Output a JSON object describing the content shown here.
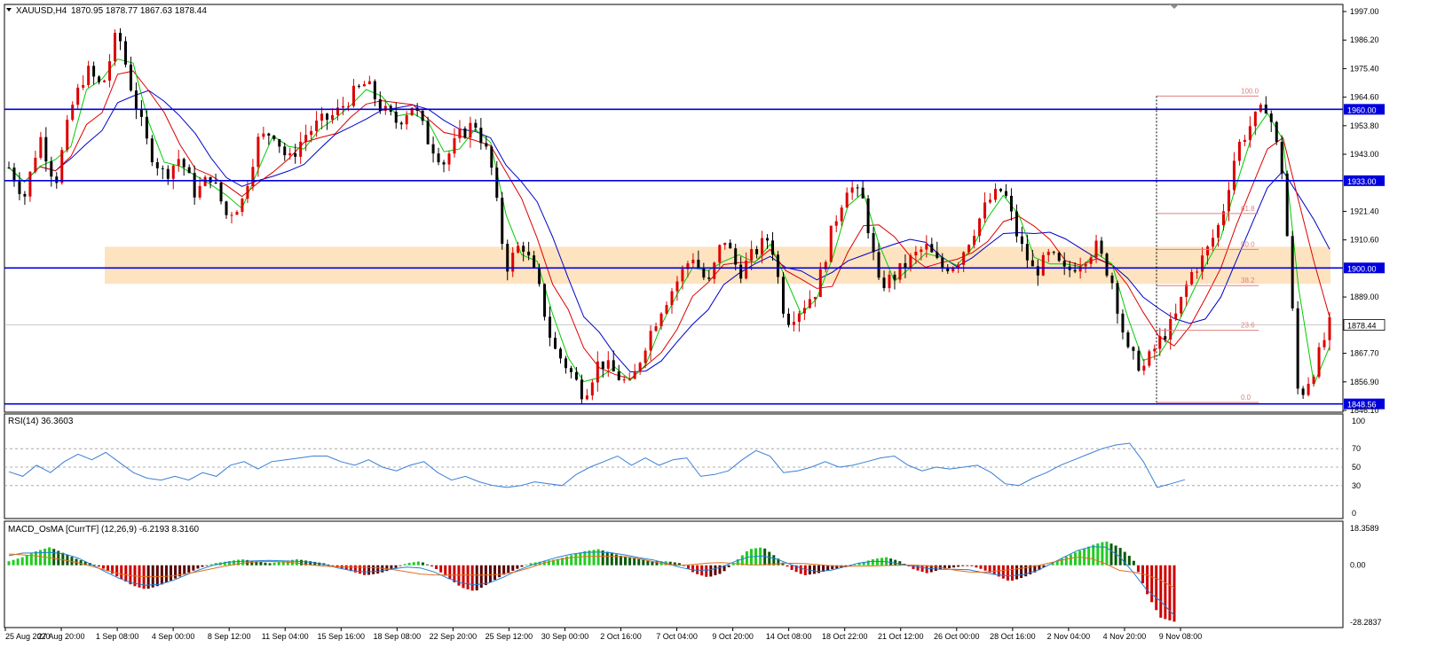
{
  "header": {
    "symbol": "XAUUSD,H4",
    "ohlc": "1870.95 1878.77 1867.63 1878.44"
  },
  "colors": {
    "bull_candle": "#dd0000",
    "bear_candle": "#000000",
    "level_line": "#0000dd",
    "zone_fill": "#fde3bf",
    "ma_fast": "#00cc00",
    "ma_mid": "#dd0000",
    "ma_slow": "#0000cc",
    "rsi_line": "#3a7fd5",
    "macd_up": "#22cc22",
    "macd_down": "#cc0000",
    "macd_line": "#1e7fd8",
    "signal_line": "#e07020",
    "fib": "#e08080",
    "grid": "#999999"
  },
  "chart_data": [
    {
      "type": "line",
      "panel": "price",
      "title": "XAUUSD,H4 1870.95 1878.77 1867.63 1878.44",
      "ylim": [
        1846.1,
        1997.0
      ],
      "y_ticks": [
        "1997.00",
        "1986.20",
        "1975.40",
        "1964.60",
        "1953.80",
        "1943.00",
        "1921.40",
        "1910.60",
        "1889.00",
        "1867.70",
        "1856.90",
        "1846.10"
      ],
      "x_ticks": [
        "25 Aug 2020",
        "27 Aug 20:00",
        "1 Sep 08:00",
        "4 Sep 00:00",
        "8 Sep 12:00",
        "11 Sep 04:00",
        "15 Sep 16:00",
        "18 Sep 08:00",
        "22 Sep 20:00",
        "25 Sep 12:00",
        "30 Sep 00:00",
        "2 Oct 16:00",
        "7 Oct 04:00",
        "9 Oct 20:00",
        "14 Oct 08:00",
        "18 Oct 22:00",
        "21 Oct 12:00",
        "26 Oct 00:00",
        "28 Oct 16:00",
        "2 Nov 04:00",
        "4 Nov 20:00",
        "9 Nov 08:00"
      ],
      "levels": [
        {
          "value": 1960.0,
          "label": "1960.00"
        },
        {
          "value": 1933.0,
          "label": "1933.00"
        },
        {
          "value": 1900.0,
          "label": "1900.00"
        },
        {
          "value": 1848.56,
          "label": "1848.56"
        }
      ],
      "current_price": {
        "value": 1878.44,
        "label": "1878.44"
      },
      "zone": {
        "from": 1894.0,
        "to": 1908.0
      },
      "fibonacci": [
        {
          "label": "100.0",
          "value": 1965.0
        },
        {
          "label": "61.8",
          "value": 1920.6
        },
        {
          "label": "50.0",
          "value": 1907.0
        },
        {
          "label": "38.2",
          "value": 1893.3
        },
        {
          "label": "23.6",
          "value": 1876.4
        },
        {
          "label": "0.0",
          "value": 1849.1
        }
      ],
      "close_path": [
        1938,
        1927,
        1950,
        1932,
        1960,
        1975,
        1968,
        1990,
        1965,
        1945,
        1935,
        1942,
        1928,
        1935,
        1920,
        1925,
        1948,
        1952,
        1940,
        1950,
        1955,
        1958,
        1965,
        1970,
        1960,
        1955,
        1962,
        1948,
        1940,
        1950,
        1955,
        1940,
        1900,
        1910,
        1895,
        1870,
        1862,
        1852,
        1865,
        1860,
        1855,
        1872,
        1885,
        1895,
        1905,
        1893,
        1912,
        1898,
        1906,
        1912,
        1880,
        1885,
        1892,
        1915,
        1932,
        1925,
        1893,
        1897,
        1903,
        1908,
        1900,
        1902,
        1913,
        1925,
        1930,
        1910,
        1898,
        1905,
        1898,
        1903,
        1908,
        1895,
        1868,
        1862,
        1872,
        1880,
        1897,
        1905,
        1918,
        1945,
        1955,
        1962,
        1935,
        1850,
        1862,
        1878.44
      ]
    },
    {
      "type": "line",
      "panel": "rsi",
      "title": "RSI(14) 36.3603",
      "ylim": [
        0,
        100
      ],
      "y_ticks": [
        "100",
        "70",
        "50",
        "30",
        "0"
      ],
      "values": [
        45,
        40,
        52,
        44,
        56,
        64,
        58,
        66,
        55,
        44,
        38,
        36,
        40,
        36,
        44,
        40,
        52,
        56,
        48,
        56,
        58,
        60,
        62,
        62,
        56,
        52,
        58,
        50,
        46,
        52,
        56,
        44,
        36,
        40,
        34,
        30,
        28,
        30,
        34,
        32,
        30,
        42,
        50,
        56,
        62,
        52,
        60,
        52,
        58,
        60,
        40,
        42,
        46,
        58,
        68,
        62,
        44,
        46,
        50,
        56,
        50,
        52,
        56,
        60,
        62,
        52,
        46,
        50,
        48,
        50,
        52,
        44,
        32,
        30,
        38,
        44,
        52,
        58,
        64,
        70,
        74,
        76,
        56,
        28,
        32,
        36.36
      ]
    },
    {
      "type": "bar",
      "panel": "macd",
      "title": "MACD_OsMA [CurrTF] (12,26,9) -6.2193 8.3160",
      "ylim": [
        -28.2837,
        18.3589
      ],
      "y_ticks": [
        "18.3589",
        "0.00",
        "-28.2837"
      ],
      "osma": [
        2,
        4,
        7,
        9,
        6,
        3,
        1,
        -2,
        -6,
        -10,
        -12,
        -10,
        -7,
        -4,
        -1,
        1,
        2,
        3,
        2,
        1,
        2,
        3,
        2,
        1,
        -1,
        -3,
        -5,
        -4,
        -2,
        1,
        2,
        -1,
        -6,
        -11,
        -13,
        -9,
        -5,
        -2,
        1,
        2,
        3,
        5,
        7,
        8,
        6,
        4,
        3,
        2,
        2,
        1,
        -4,
        -6,
        -4,
        2,
        8,
        9,
        4,
        -2,
        -5,
        -4,
        -2,
        -1,
        1,
        3,
        4,
        2,
        -2,
        -4,
        -2,
        -1,
        0,
        -2,
        -5,
        -8,
        -6,
        -3,
        1,
        4,
        7,
        10,
        12,
        9,
        3,
        -14,
        -26,
        -28
      ]
    }
  ]
}
